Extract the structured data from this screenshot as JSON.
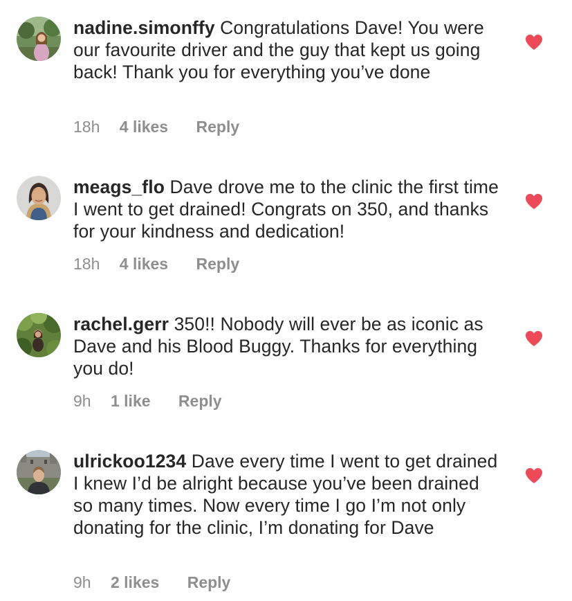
{
  "theme": {
    "heart_color": "#ed4956",
    "meta_color": "#8e8e8e",
    "text_color": "#262626"
  },
  "comments": [
    {
      "username": "nadine.simonffy",
      "text": "Congratulations Dave! You were our favourite driver and the guy that kept us going back! Thank you for everything you’ve done",
      "time": "18h",
      "likes": "4 likes",
      "reply_label": "Reply",
      "liked": true,
      "like_icon": "heart-filled-icon"
    },
    {
      "username": "meags_flo",
      "text": "Dave drove me to the clinic the first time I went to get drained! Congrats on 350, and thanks for your kindness and dedication!",
      "time": "18h",
      "likes": "4 likes",
      "reply_label": "Reply",
      "liked": true,
      "like_icon": "heart-filled-icon"
    },
    {
      "username": "rachel.gerr",
      "text": "350!! Nobody will ever be as iconic as Dave and his Blood Buggy. Thanks for everything you do!",
      "time": "9h",
      "likes": "1 like",
      "reply_label": "Reply",
      "liked": true,
      "like_icon": "heart-filled-icon"
    },
    {
      "username": "ulrickoo1234",
      "text": "Dave every time I went to get drained I knew I’d be alright because you’ve been drained so many times. Now every time I go I’m not only donating for the clinic, I’m donating for Dave",
      "time": "9h",
      "likes": "2 likes",
      "reply_label": "Reply",
      "liked": true,
      "like_icon": "heart-filled-icon"
    }
  ]
}
